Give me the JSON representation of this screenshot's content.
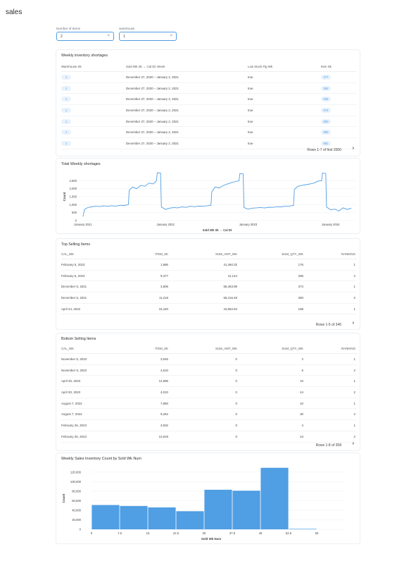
{
  "page": {
    "title": "sales"
  },
  "filters": [
    {
      "label": "Number of Items",
      "value": "2"
    },
    {
      "label": "warehouse",
      "value": "1"
    }
  ],
  "cards": {
    "weekly_shortages": {
      "title": "Weekly inventory shortages",
      "columns": [
        "Warehouse Sk",
        "Sold Wk Sk → Cal Dt: Week",
        "Low Stock Flg Wk",
        "Item Sk"
      ],
      "rows": [
        [
          "1",
          "December 27, 2020 – January 2, 2021",
          "true",
          "277"
        ],
        [
          "1",
          "December 27, 2020 – January 2, 2021",
          "true",
          "362"
        ],
        [
          "1",
          "December 27, 2020 – January 2, 2021",
          "true",
          "535"
        ],
        [
          "1",
          "December 27, 2020 – January 2, 2021",
          "true",
          "572"
        ],
        [
          "1",
          "December 27, 2020 – January 2, 2021",
          "true",
          "800"
        ],
        [
          "1",
          "December 27, 2020 – January 2, 2021",
          "true",
          "950"
        ],
        [
          "1",
          "December 27, 2020 – January 2, 2021",
          "true",
          "981"
        ]
      ],
      "pagination": "Rows 1-7 of first 2000"
    },
    "total_weekly": {
      "title": "Total Weekly shortages"
    },
    "top_selling": {
      "title": "Top Selling Items",
      "columns": [
        "CAL_WK",
        "ITEM_SK",
        "SUM_AMT_WK",
        "SUM_QTY_WK",
        "RANKING"
      ],
      "rows": [
        [
          "February 5, 2023",
          "1,886",
          "41,460.32",
          "176",
          "1"
        ],
        [
          "February 5, 2023",
          "9,377",
          "41,144",
          "296",
          "2"
        ],
        [
          "December 5, 2021",
          "3,806",
          "55,453.98",
          "374",
          "1"
        ],
        [
          "December 5, 2021",
          "11,218",
          "55,416.48",
          "280",
          "2"
        ],
        [
          "April 24, 2022",
          "15,440",
          "44,862.84",
          "198",
          "1"
        ]
      ],
      "pagination": "Rows 1-5 of 346"
    },
    "bottom_selling": {
      "title": "Bottom Selling Items",
      "columns": [
        "CAL_WK",
        "ITEM_SK",
        "SUM_AMT_WK",
        "SUM_QTY_WK",
        "RANKING"
      ],
      "rows": [
        [
          "November 5, 2023",
          "3,545",
          "0",
          "2",
          "1"
        ],
        [
          "November 5, 2023",
          "4,610",
          "0",
          "6",
          "2"
        ],
        [
          "April 30, 2023",
          "14,995",
          "0",
          "10",
          "1"
        ],
        [
          "April 30, 2023",
          "4,010",
          "0",
          "44",
          "2"
        ],
        [
          "August 7, 2022",
          "7,850",
          "0",
          "10",
          "1"
        ],
        [
          "August 7, 2022",
          "9,262",
          "0",
          "30",
          "2"
        ],
        [
          "February 26, 2023",
          "3,932",
          "0",
          "4",
          "1"
        ],
        [
          "February 26, 2023",
          "13,919",
          "0",
          "24",
          "2"
        ]
      ],
      "pagination": "Rows 1-8 of 358"
    },
    "histogram": {
      "title": "Weekly Sales Inventory Count by Sold Wk Num"
    }
  },
  "chart_data": [
    {
      "type": "line",
      "xlabel": "Sold Wk Sk → Cal Dt",
      "ylabel": "Count",
      "ylim": [
        0,
        3000
      ],
      "y_ticks": [
        "0",
        "500",
        "1,000",
        "1,500",
        "2,000",
        "2,500"
      ],
      "x_ticks": [
        "January 2021",
        "January 2022",
        "January 2023",
        "January 2024"
      ],
      "series_color": "#509ee3",
      "series": [
        {
          "x": [
            2021.0,
            2021.02,
            2021.06,
            2021.1,
            2021.15,
            2021.2,
            2021.25,
            2021.3,
            2021.35,
            2021.4,
            2021.45,
            2021.5,
            2021.55,
            2021.56,
            2021.6,
            2021.65,
            2021.7,
            2021.75,
            2021.8,
            2021.85,
            2021.89,
            2021.9,
            2021.94,
            2021.95,
            2022.0,
            2022.05,
            2022.1,
            2022.15,
            2022.2,
            2022.25,
            2022.3,
            2022.35,
            2022.4,
            2022.45,
            2022.5,
            2022.55,
            2022.56,
            2022.6,
            2022.65,
            2022.7,
            2022.75,
            2022.8,
            2022.85,
            2022.89,
            2022.9,
            2022.94,
            2022.95,
            2023.0,
            2023.05,
            2023.1,
            2023.15,
            2023.2,
            2023.25,
            2023.3,
            2023.35,
            2023.4,
            2023.45,
            2023.5,
            2023.55,
            2023.56,
            2023.6,
            2023.65,
            2023.7,
            2023.75,
            2023.8,
            2023.85,
            2023.89,
            2023.9,
            2023.94,
            2023.95,
            2024.0,
            2024.05,
            2024.1,
            2024.15,
            2024.2,
            2024.25
          ],
          "y": [
            250,
            700,
            820,
            860,
            900,
            880,
            920,
            900,
            930,
            910,
            960,
            950,
            1000,
            1900,
            2100,
            2000,
            2200,
            2150,
            2350,
            2300,
            2500,
            3000,
            2980,
            850,
            700,
            780,
            820,
            800,
            860,
            830,
            900,
            870,
            910,
            900,
            920,
            960,
            1800,
            2100,
            2050,
            2200,
            2300,
            2380,
            2450,
            2500,
            2950,
            2920,
            820,
            720,
            780,
            800,
            820,
            790,
            840,
            830,
            870,
            860,
            900,
            910,
            950,
            1950,
            2150,
            2200,
            2250,
            2300,
            2350,
            2480,
            2500,
            2980,
            2950,
            850,
            680,
            720,
            600,
            800,
            700,
            780
          ]
        }
      ]
    },
    {
      "type": "bar",
      "xlabel": "Sold Wk Num",
      "ylabel": "Count",
      "ylim": [
        0,
        130000
      ],
      "y_ticks": [
        "0",
        "20,000",
        "40,000",
        "60,000",
        "80,000",
        "100,000",
        "120,000"
      ],
      "x_ticks": [
        "0",
        "7.5",
        "15",
        "22.5",
        "30",
        "37.5",
        "45",
        "52.5",
        "60"
      ],
      "series_color": "#509ee3",
      "bins": [
        [
          0,
          7.5
        ],
        [
          7.5,
          15
        ],
        [
          15,
          22.5
        ],
        [
          22.5,
          30
        ],
        [
          30,
          37.5
        ],
        [
          37.5,
          45
        ],
        [
          45,
          52.5
        ],
        [
          52.5,
          60
        ]
      ],
      "values": [
        51000,
        49000,
        46000,
        38000,
        83000,
        81000,
        129000,
        1000
      ]
    }
  ]
}
